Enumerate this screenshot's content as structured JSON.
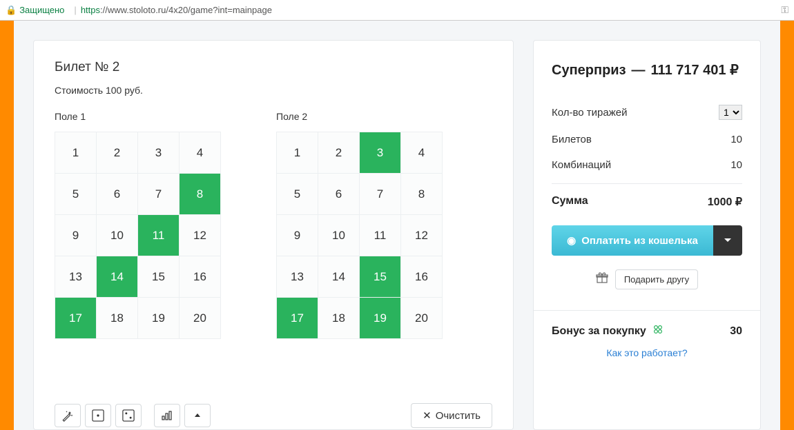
{
  "browser": {
    "secure_label": "Защищено",
    "url_https": "https",
    "url_rest": "://www.stoloto.ru/4x20/game?int=mainpage"
  },
  "ticket": {
    "title": "Билет № 2",
    "cost": "Стоимость 100 руб.",
    "fields": [
      {
        "label": "Поле 1",
        "cells": [
          1,
          2,
          3,
          4,
          5,
          6,
          7,
          8,
          9,
          10,
          11,
          12,
          13,
          14,
          15,
          16,
          17,
          18,
          19,
          20
        ],
        "selected": [
          8,
          11,
          14,
          17
        ]
      },
      {
        "label": "Поле 2",
        "cells": [
          1,
          2,
          3,
          4,
          5,
          6,
          7,
          8,
          9,
          10,
          11,
          12,
          13,
          14,
          15,
          16,
          17,
          18,
          19,
          20
        ],
        "selected": [
          3,
          15,
          17,
          19
        ]
      }
    ],
    "clear_button": "Очистить"
  },
  "sidebar": {
    "jackpot_label": "Суперприз",
    "jackpot_amount": "111 717 401 ₽",
    "draws_label": "Кол-во тиражей",
    "draws_value": "1",
    "tickets_label": "Билетов",
    "tickets_value": "10",
    "combos_label": "Комбинаций",
    "combos_value": "10",
    "total_label": "Сумма",
    "total_value": "1000 ₽",
    "pay_button": "Оплатить из кошелька",
    "gift_button": "Подарить другу",
    "bonus_label": "Бонус за покупку",
    "bonus_value": "30",
    "how_link": "Как это работает?"
  }
}
